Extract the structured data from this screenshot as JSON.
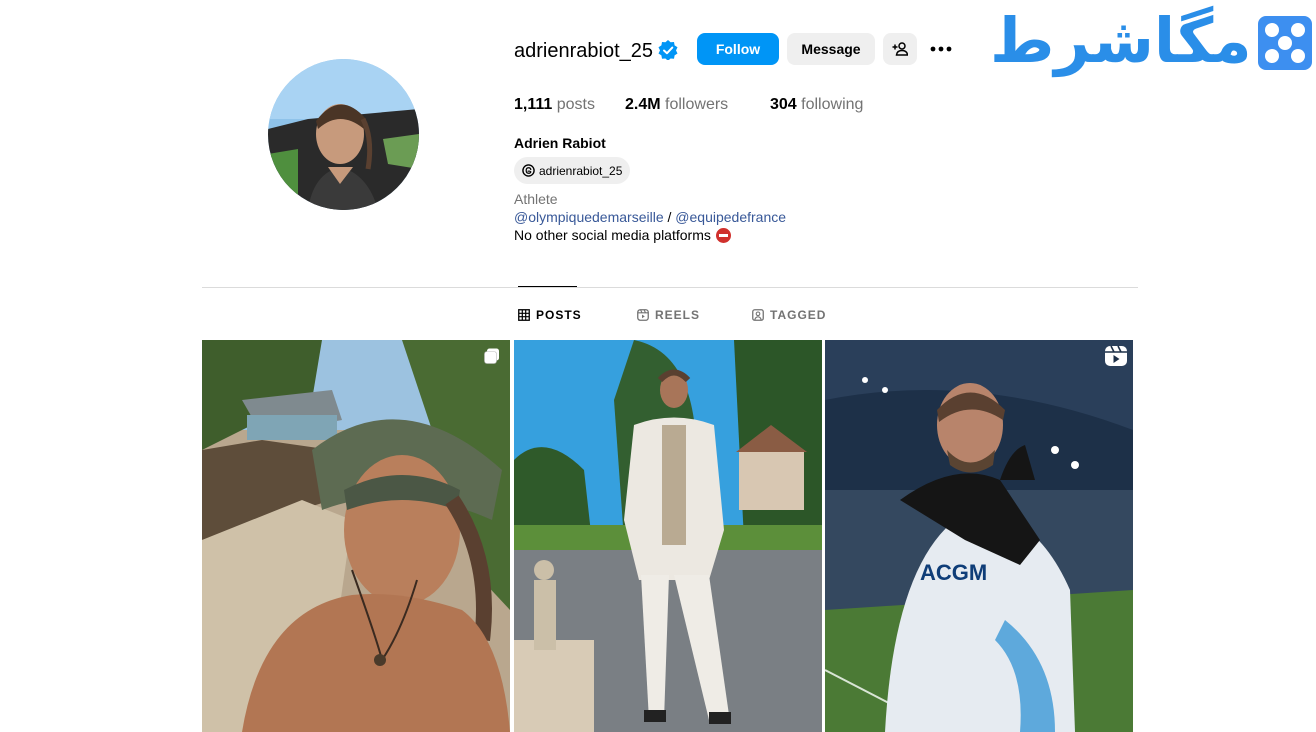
{
  "profile": {
    "username": "adrienrabiot_25",
    "full_name": "Adrien Rabiot",
    "threads_handle": "adrienrabiot_25",
    "category": "Athlete",
    "bio_link_1": "@olympiquedemarseille",
    "bio_separator": " / ",
    "bio_link_2": "@equipedefrance",
    "bio_text": "No other social media platforms",
    "verified_icon": "verified-badge-icon",
    "avatar_icon": "avatar-photo"
  },
  "actions": {
    "follow_label": "Follow",
    "message_label": "Message",
    "add_user_icon": "person-add-icon",
    "more_icon": "more-options-icon"
  },
  "stats": {
    "posts_count": "1,111",
    "posts_label": "posts",
    "followers_count": "2.4M",
    "followers_label": "followers",
    "following_count": "304",
    "following_label": "following"
  },
  "tabs": [
    {
      "label": "POSTS",
      "icon": "grid-icon",
      "active": true
    },
    {
      "label": "REELS",
      "icon": "reels-icon",
      "active": false
    },
    {
      "label": "TAGGED",
      "icon": "tagged-icon",
      "active": false
    }
  ],
  "posts": [
    {
      "subject": "selfie with bucket hat by the sea",
      "badge": "carousel-icon"
    },
    {
      "subject": "standing in white outfit outdoors",
      "badge": ""
    },
    {
      "subject": "celebrating in stadium in white kit",
      "badge": "reel-icon"
    }
  ],
  "watermark": {
    "text": "مگاشرط"
  },
  "colors": {
    "accent": "#0095f6",
    "link": "#385898",
    "muted": "#737373",
    "button_bg": "#efefef",
    "watermark": "#2a8ee8"
  }
}
